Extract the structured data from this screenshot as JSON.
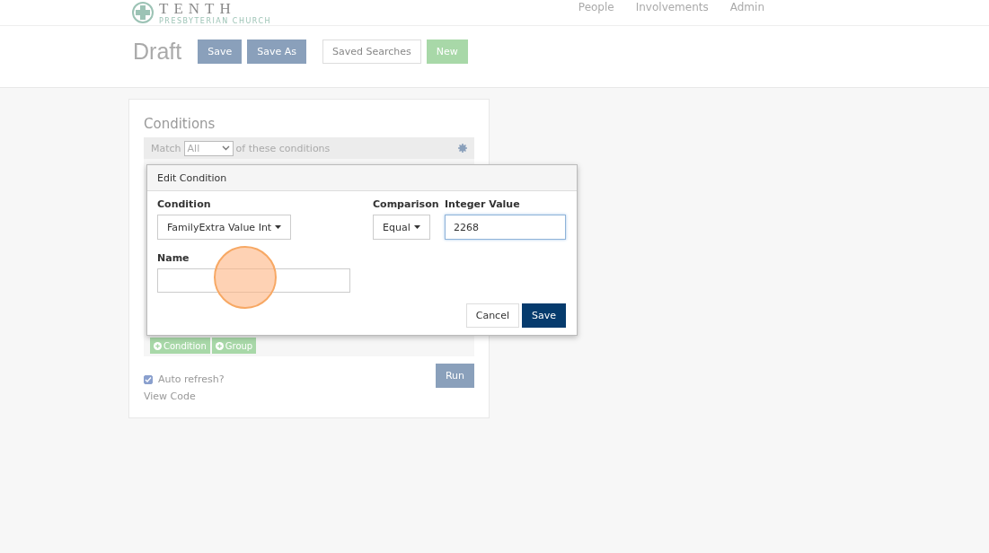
{
  "header": {
    "logo_title": "TENTH",
    "logo_subtitle": "PRESBYTERIAN CHURCH",
    "nav": [
      "People",
      "Involvements",
      "Admin"
    ]
  },
  "toolbar": {
    "title": "Draft",
    "buttons": [
      {
        "label": "Save",
        "kind": "primary"
      },
      {
        "label": "Save As",
        "kind": "primary"
      },
      {
        "label": "Saved Searches",
        "kind": "default"
      },
      {
        "label": "New",
        "kind": "success"
      }
    ]
  },
  "conditions": {
    "title": "Conditions",
    "match_label": "Match",
    "match_value": "All",
    "match_suffix": "of these conditions",
    "add_buttons": [
      "Condition",
      "Group"
    ]
  },
  "auto_refresh": {
    "label": "Auto refresh?",
    "checked": true
  },
  "run_button": "Run",
  "view_code": "View Code",
  "dialog": {
    "title": "Edit Condition",
    "condition_label": "Condition",
    "condition_value": "FamilyExtra Value Int",
    "comparison_label": "Comparison",
    "comparison_value": "Equal",
    "value_label": "Integer Value",
    "value": "2268",
    "name_label": "Name",
    "buttons": [
      {
        "label": "Cancel",
        "kind": "default"
      },
      {
        "label": "Save",
        "kind": "dark"
      }
    ]
  }
}
